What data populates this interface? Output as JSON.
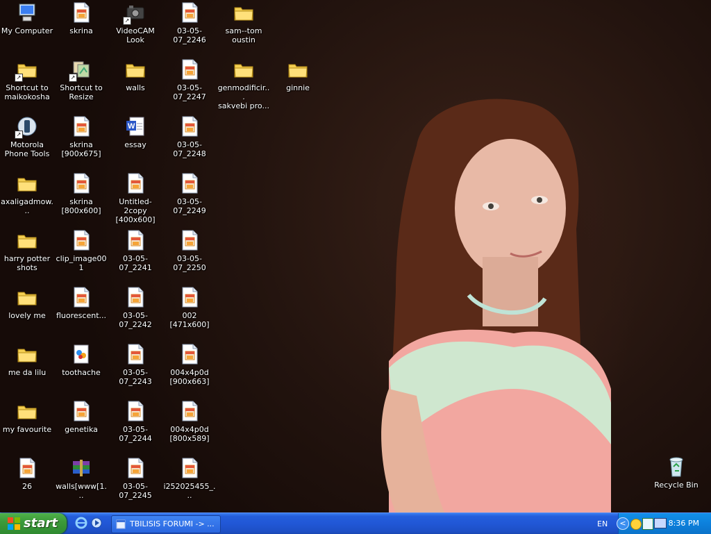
{
  "desktop": {
    "icons": [
      {
        "label": [
          "My Computer"
        ],
        "icon": "computer-icon",
        "x": 0,
        "y": 0
      },
      {
        "label": [
          "skrina"
        ],
        "icon": "image-file-icon",
        "x": 1,
        "y": 0
      },
      {
        "label": [
          "VideoCAM Look"
        ],
        "icon": "camera-shortcut-icon",
        "x": 2,
        "y": 0
      },
      {
        "label": [
          "03-05-07_2246"
        ],
        "icon": "image-file-icon",
        "x": 3,
        "y": 0
      },
      {
        "label": [
          "sam--tom",
          "oustin"
        ],
        "icon": "folder-icon",
        "x": 4,
        "y": 0
      },
      {
        "label": [
          "Shortcut to",
          "maikokosha"
        ],
        "icon": "folder-shortcut-icon",
        "x": 0,
        "y": 1
      },
      {
        "label": [
          "Shortcut to",
          "Resize"
        ],
        "icon": "resize-shortcut-icon",
        "x": 1,
        "y": 1
      },
      {
        "label": [
          "walls"
        ],
        "icon": "folder-icon",
        "x": 2,
        "y": 1
      },
      {
        "label": [
          "03-05-07_2247"
        ],
        "icon": "image-file-icon",
        "x": 3,
        "y": 1
      },
      {
        "label": [
          "genmodificir...",
          "sakvebi pro..."
        ],
        "icon": "folder-icon",
        "x": 4,
        "y": 1
      },
      {
        "label": [
          "ginnie"
        ],
        "icon": "folder-icon",
        "x": 5,
        "y": 1
      },
      {
        "label": [
          "Motorola",
          "Phone Tools"
        ],
        "icon": "motorola-shortcut-icon",
        "x": 0,
        "y": 2
      },
      {
        "label": [
          "skrina",
          "[900x675]"
        ],
        "icon": "image-file-icon",
        "x": 1,
        "y": 2
      },
      {
        "label": [
          "essay"
        ],
        "icon": "word-document-icon",
        "x": 2,
        "y": 2
      },
      {
        "label": [
          "03-05-07_2248"
        ],
        "icon": "image-file-icon",
        "x": 3,
        "y": 2
      },
      {
        "label": [
          "axaligadmow..."
        ],
        "icon": "folder-icon",
        "x": 0,
        "y": 3
      },
      {
        "label": [
          "skrina",
          "[800x600]"
        ],
        "icon": "image-file-icon",
        "x": 1,
        "y": 3
      },
      {
        "label": [
          "Untitled-2copy",
          "[400x600]"
        ],
        "icon": "image-file-icon",
        "x": 2,
        "y": 3
      },
      {
        "label": [
          "03-05-07_2249"
        ],
        "icon": "image-file-icon",
        "x": 3,
        "y": 3
      },
      {
        "label": [
          "harry potter",
          "shots"
        ],
        "icon": "folder-icon",
        "x": 0,
        "y": 4
      },
      {
        "label": [
          "clip_image001"
        ],
        "icon": "image-file-icon",
        "x": 1,
        "y": 4
      },
      {
        "label": [
          "03-05-07_2241"
        ],
        "icon": "image-file-icon",
        "x": 2,
        "y": 4
      },
      {
        "label": [
          "03-05-07_2250"
        ],
        "icon": "image-file-icon",
        "x": 3,
        "y": 4
      },
      {
        "label": [
          "lovely me"
        ],
        "icon": "folder-icon",
        "x": 0,
        "y": 5
      },
      {
        "label": [
          "fluorescent..."
        ],
        "icon": "image-file-icon",
        "x": 1,
        "y": 5
      },
      {
        "label": [
          "03-05-07_2242"
        ],
        "icon": "image-file-icon",
        "x": 2,
        "y": 5
      },
      {
        "label": [
          "002 [471x600]"
        ],
        "icon": "image-file-icon",
        "x": 3,
        "y": 5
      },
      {
        "label": [
          "me da lilu"
        ],
        "icon": "folder-icon",
        "x": 0,
        "y": 6
      },
      {
        "label": [
          "toothache"
        ],
        "icon": "paint-file-icon",
        "x": 1,
        "y": 6
      },
      {
        "label": [
          "03-05-07_2243"
        ],
        "icon": "image-file-icon",
        "x": 2,
        "y": 6
      },
      {
        "label": [
          "004x4p0d",
          "[900x663]"
        ],
        "icon": "image-file-icon",
        "x": 3,
        "y": 6
      },
      {
        "label": [
          "my favourite"
        ],
        "icon": "folder-icon",
        "x": 0,
        "y": 7
      },
      {
        "label": [
          "genetika"
        ],
        "icon": "image-file-icon",
        "x": 1,
        "y": 7
      },
      {
        "label": [
          "03-05-07_2244"
        ],
        "icon": "image-file-icon",
        "x": 2,
        "y": 7
      },
      {
        "label": [
          "004x4p0d",
          "[800x589]"
        ],
        "icon": "image-file-icon",
        "x": 3,
        "y": 7
      },
      {
        "label": [
          "26"
        ],
        "icon": "image-file-icon",
        "x": 0,
        "y": 8
      },
      {
        "label": [
          "walls[www[1..."
        ],
        "icon": "winrar-archive-icon",
        "x": 1,
        "y": 8
      },
      {
        "label": [
          "03-05-07_2245"
        ],
        "icon": "image-file-icon",
        "x": 2,
        "y": 8
      },
      {
        "label": [
          "i252025455_..."
        ],
        "icon": "image-file-icon",
        "x": 3,
        "y": 8
      }
    ],
    "recycle_bin": {
      "label": "Recycle Bin",
      "icon": "recycle-bin-icon"
    }
  },
  "taskbar": {
    "start_label": "start",
    "quick_launch": [
      "internet-explorer-icon",
      "windows-media-player-icon"
    ],
    "task_button": "TBILISIS FORUMI -> ...",
    "language": "EN",
    "tray_icons": [
      "show-hidden-icons-chevron-icon",
      "smiley-messenger-icon",
      "network-icon",
      "display-icon"
    ],
    "clock": "8:36 PM"
  },
  "colors": {
    "taskbar_blue": "#245edb",
    "start_green": "#3c9a3a",
    "tray_blue": "#0d80dc"
  }
}
